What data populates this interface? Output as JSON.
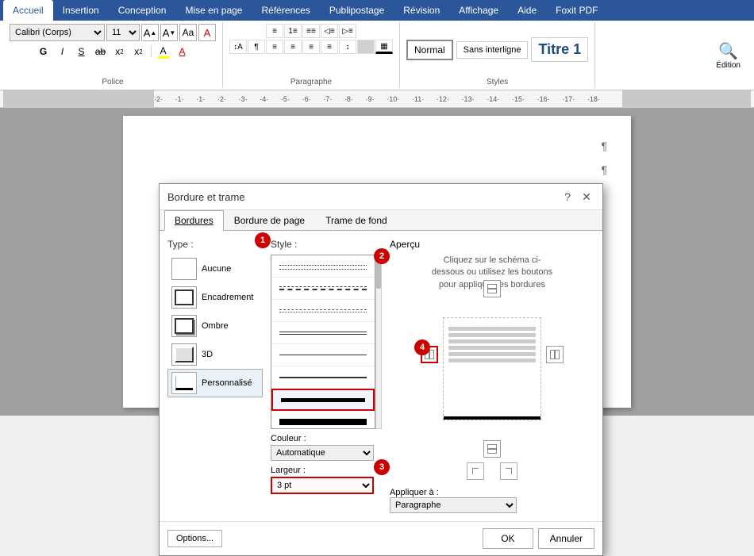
{
  "ribbon": {
    "tabs": [
      "Accueil",
      "Insertion",
      "Conception",
      "Mise en page",
      "Références",
      "Publipostage",
      "Révision",
      "Affichage",
      "Aide",
      "Foxit PDF"
    ],
    "active_tab": "Accueil",
    "font_group": {
      "label": "Police",
      "font_name": "Calibri (Corps)",
      "font_size": "11",
      "bold": "G",
      "italic": "I",
      "underline": "S",
      "strikethrough": "ab",
      "subscript": "x₂",
      "superscript": "x²"
    },
    "styles": {
      "normal_label": "Normal",
      "sans_interligne_label": "Sans interligne",
      "titre1_label": "Titre 1"
    },
    "edition_label": "Édition"
  },
  "dialog": {
    "title": "Bordure et trame",
    "tabs": [
      "Bordures",
      "Bordure de page",
      "Trame de fond"
    ],
    "active_tab": "Bordures",
    "type_section_label": "Type :",
    "types": [
      {
        "label": "Aucune",
        "icon": "none"
      },
      {
        "label": "Encadrement",
        "icon": "box"
      },
      {
        "label": "Ombre",
        "icon": "shadow"
      },
      {
        "label": "3D",
        "icon": "3d"
      },
      {
        "label": "Personnalisé",
        "icon": "custom"
      }
    ],
    "style_section_label": "Style :",
    "styles": [
      "dotted1",
      "dashed1",
      "dot-dash",
      "long-dash",
      "solid-thin",
      "solid-medium",
      "solid-thick",
      "solid-xthick"
    ],
    "color_label": "Couleur :",
    "color_value": "Automatique",
    "width_label": "Largeur :",
    "width_value": "3 pt",
    "apercu_label": "Aperçu",
    "apercu_hint": "Cliquez sur le schéma ci-dessous ou utilisez les boutons pour appliquer les bordures",
    "apply_label": "Appliquer à :",
    "apply_value": "Paragraphe",
    "btn_options": "Options...",
    "btn_ok": "OK",
    "btn_annuler": "Annuler",
    "badge1": "1",
    "badge2": "2",
    "badge3": "3",
    "badge4": "4"
  },
  "colors": {
    "accent_blue": "#2b579a",
    "badge_red": "#cc0000",
    "selected_border": "#cc0000"
  }
}
